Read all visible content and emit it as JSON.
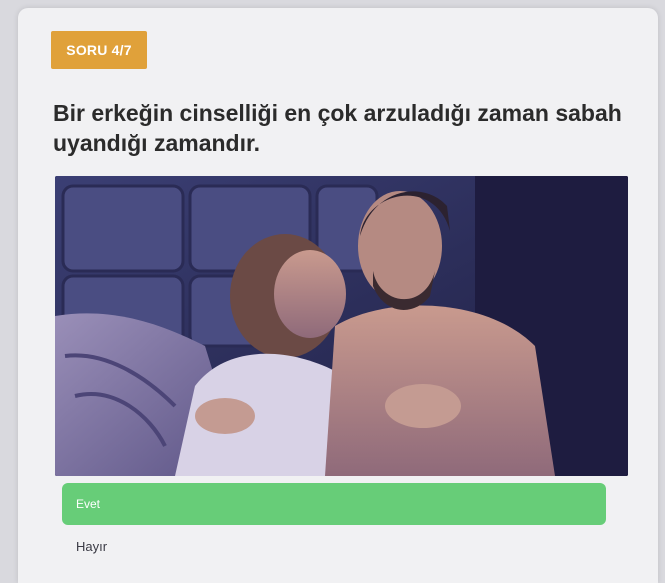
{
  "quiz": {
    "progress_label": "SORU 4/7",
    "question": "Bir erkeğin cinselliği en çok arzuladığı zaman sabah uyandığı zamandır.",
    "options": [
      {
        "label": "Evet",
        "selected": true
      },
      {
        "label": "Hayır",
        "selected": false
      }
    ]
  },
  "colors": {
    "badge": "#e0a13a",
    "selected_option": "#67cd78",
    "question_text": "#2b2b2b"
  }
}
